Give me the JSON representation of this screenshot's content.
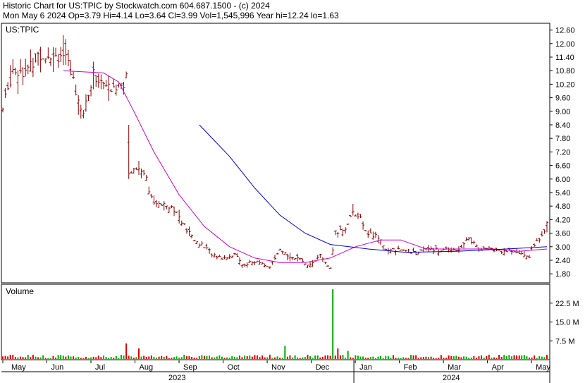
{
  "header": {
    "line1": "Historic Chart for US:TPIC by Stockwatch.com 604.687.1500 - (c) 2024",
    "line2": "Mon May  6 2024  Op=3.79  Hi=4.14  Lo=3.64  Cl=3.99  Vol=1,545,996  Year hi=12.24  lo=1.63"
  },
  "colors": {
    "price_bar": "#8b0000",
    "ma_short": "#cc00cc",
    "ma_long": "#0000cc",
    "volume_up": "#00aa00",
    "volume_down": "#dd0000",
    "frame": "#000000"
  },
  "chart_data": [
    {
      "type": "ohlc",
      "symbol_label": "US:TPIC",
      "y_ticks": [
        "12.60",
        "12.00",
        "11.40",
        "10.80",
        "10.20",
        "9.60",
        "9.00",
        "8.40",
        "7.80",
        "7.20",
        "6.60",
        "6.00",
        "5.40",
        "4.80",
        "4.20",
        "3.60",
        "3.00",
        "2.40",
        "1.80"
      ],
      "ylim": [
        1.4,
        12.9
      ],
      "x_month_labels": [
        "May",
        "Jun",
        "Jul",
        "Aug",
        "Sep",
        "Oct",
        "Nov",
        "Dec",
        "Jan",
        "Feb",
        "Mar",
        "Apr",
        "May"
      ],
      "year_labels": [
        "2023",
        "2024"
      ],
      "series_price_close": [
        {
          "t": 0,
          "v": 9.1
        },
        {
          "t": 4,
          "v": 10.9
        },
        {
          "t": 10,
          "v": 10.8
        },
        {
          "t": 14,
          "v": 11.5
        },
        {
          "t": 19,
          "v": 11.6
        },
        {
          "t": 24,
          "v": 11.5
        },
        {
          "t": 28,
          "v": 10.4
        },
        {
          "t": 32,
          "v": 8.9
        },
        {
          "t": 36,
          "v": 10.6
        },
        {
          "t": 40,
          "v": 10.2
        },
        {
          "t": 44,
          "v": 9.9
        },
        {
          "t": 47,
          "v": 10.4
        },
        {
          "t": 49,
          "v": 10.1
        },
        {
          "t": 50,
          "v": 6.3
        },
        {
          "t": 53,
          "v": 6.5
        },
        {
          "t": 56,
          "v": 6.4
        },
        {
          "t": 60,
          "v": 4.8
        },
        {
          "t": 64,
          "v": 5.0
        },
        {
          "t": 68,
          "v": 4.7
        },
        {
          "t": 72,
          "v": 3.9
        },
        {
          "t": 76,
          "v": 3.3
        },
        {
          "t": 80,
          "v": 3.0
        },
        {
          "t": 84,
          "v": 2.6
        },
        {
          "t": 88,
          "v": 2.5
        },
        {
          "t": 92,
          "v": 2.7
        },
        {
          "t": 95,
          "v": 2.2
        },
        {
          "t": 98,
          "v": 2.3
        },
        {
          "t": 102,
          "v": 2.3
        },
        {
          "t": 106,
          "v": 2.1
        },
        {
          "t": 110,
          "v": 2.8
        },
        {
          "t": 114,
          "v": 2.6
        },
        {
          "t": 118,
          "v": 2.4
        },
        {
          "t": 122,
          "v": 2.2
        },
        {
          "t": 126,
          "v": 2.6
        },
        {
          "t": 130,
          "v": 2.0
        },
        {
          "t": 132,
          "v": 3.6
        },
        {
          "t": 136,
          "v": 3.8
        },
        {
          "t": 139,
          "v": 4.6
        },
        {
          "t": 142,
          "v": 4.2
        },
        {
          "t": 145,
          "v": 3.6
        },
        {
          "t": 149,
          "v": 3.4
        },
        {
          "t": 153,
          "v": 2.8
        },
        {
          "t": 157,
          "v": 2.9
        },
        {
          "t": 161,
          "v": 2.8
        },
        {
          "t": 165,
          "v": 2.7
        },
        {
          "t": 169,
          "v": 3.0
        },
        {
          "t": 173,
          "v": 2.8
        },
        {
          "t": 177,
          "v": 2.9
        },
        {
          "t": 181,
          "v": 2.9
        },
        {
          "t": 185,
          "v": 3.4
        },
        {
          "t": 189,
          "v": 2.9
        },
        {
          "t": 193,
          "v": 2.9
        },
        {
          "t": 197,
          "v": 2.8
        },
        {
          "t": 201,
          "v": 2.8
        },
        {
          "t": 205,
          "v": 2.7
        },
        {
          "t": 209,
          "v": 2.6
        },
        {
          "t": 213,
          "v": 3.4
        },
        {
          "t": 216,
          "v": 3.99
        }
      ],
      "series_ma_short": [
        {
          "t": 24,
          "v": 10.8
        },
        {
          "t": 40,
          "v": 10.7
        },
        {
          "t": 46,
          "v": 10.3
        },
        {
          "t": 52,
          "v": 9.0
        },
        {
          "t": 60,
          "v": 7.2
        },
        {
          "t": 70,
          "v": 5.3
        },
        {
          "t": 80,
          "v": 3.9
        },
        {
          "t": 90,
          "v": 3.0
        },
        {
          "t": 100,
          "v": 2.5
        },
        {
          "t": 110,
          "v": 2.3
        },
        {
          "t": 120,
          "v": 2.3
        },
        {
          "t": 130,
          "v": 2.5
        },
        {
          "t": 140,
          "v": 3.0
        },
        {
          "t": 150,
          "v": 3.3
        },
        {
          "t": 158,
          "v": 3.3
        },
        {
          "t": 168,
          "v": 2.9
        },
        {
          "t": 180,
          "v": 2.9
        },
        {
          "t": 195,
          "v": 2.9
        },
        {
          "t": 205,
          "v": 2.8
        },
        {
          "t": 216,
          "v": 2.9
        }
      ],
      "series_ma_long": [
        {
          "t": 78,
          "v": 8.4
        },
        {
          "t": 90,
          "v": 7.0
        },
        {
          "t": 100,
          "v": 5.6
        },
        {
          "t": 110,
          "v": 4.4
        },
        {
          "t": 120,
          "v": 3.6
        },
        {
          "t": 130,
          "v": 3.1
        },
        {
          "t": 145,
          "v": 2.9
        },
        {
          "t": 160,
          "v": 2.75
        },
        {
          "t": 180,
          "v": 2.8
        },
        {
          "t": 200,
          "v": 2.9
        },
        {
          "t": 216,
          "v": 3.0
        }
      ]
    },
    {
      "type": "bar",
      "title": "Volume",
      "y_ticks": [
        "22.5 M",
        "15.0 M",
        "7.5 M"
      ],
      "ylim": [
        0,
        30
      ],
      "spike_values": [
        {
          "t": 49,
          "v": 6.5
        },
        {
          "t": 54,
          "v": 4.5
        },
        {
          "t": 112,
          "v": 5.5
        },
        {
          "t": 131,
          "v": 28.0
        },
        {
          "t": 133,
          "v": 4.5
        },
        {
          "t": 137,
          "v": 3.5
        }
      ]
    }
  ]
}
